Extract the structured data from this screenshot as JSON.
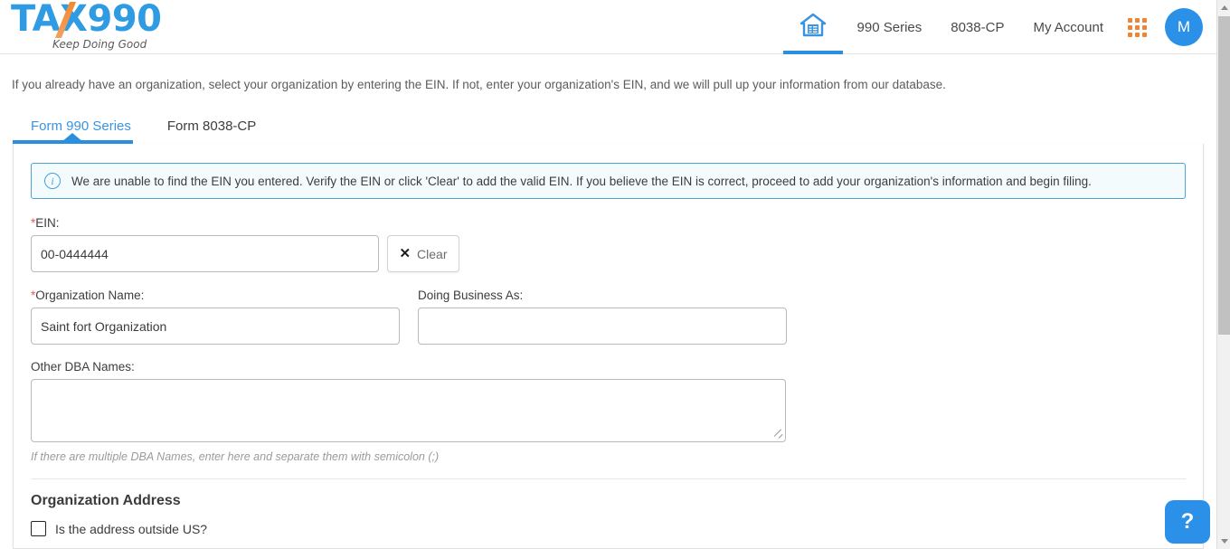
{
  "header": {
    "logo": {
      "text_main": "TA",
      "text_x": "X",
      "text_end": "990",
      "tagline": "Keep Doing Good"
    },
    "nav": {
      "home_icon": "home-icon",
      "links": [
        {
          "label": "990 Series"
        },
        {
          "label": "8038-CP"
        },
        {
          "label": "My Account"
        }
      ],
      "apps_icon": "apps-grid-icon",
      "avatar_initial": "M"
    }
  },
  "intro": {
    "text": "If you already have an organization, select your organization by entering the EIN. If not, enter your organization's EIN, and we will pull up your information from our database."
  },
  "tabs": [
    {
      "label": "Form 990 Series",
      "active": true
    },
    {
      "label": "Form 8038-CP",
      "active": false
    }
  ],
  "alert": {
    "icon": "info-circle-icon",
    "text": "We are unable to find the EIN you entered. Verify the EIN or click 'Clear' to add the valid EIN. If you believe the EIN is correct, proceed to add your organization's information and begin filing."
  },
  "form": {
    "ein": {
      "label": "EIN:",
      "required_marker": "*",
      "value": "00-0444444",
      "placeholder": ""
    },
    "clear_button": {
      "label": "Clear",
      "icon": "close-x-icon"
    },
    "organization_name": {
      "label": "Organization Name:",
      "required_marker": "*",
      "value": "Saint fort Organization",
      "placeholder": ""
    },
    "doing_business_as": {
      "label": "Doing Business As:",
      "value": "",
      "placeholder": ""
    },
    "other_dba_names": {
      "label": "Other DBA Names:",
      "value": "",
      "placeholder": "",
      "hint": "If there are multiple DBA Names, enter here and separate them with semicolon (;)"
    },
    "address_section": {
      "heading": "Organization Address",
      "outside_us_checkbox": {
        "label": "Is the address outside US?",
        "checked": false
      }
    }
  },
  "help_button": {
    "label": "?"
  },
  "colors": {
    "brand_blue": "#2f9be3",
    "accent_orange": "#ef8534",
    "nav_active": "#2b8fe0",
    "required_red": "#e8604c",
    "alert_border": "#4ea3d6",
    "alert_bg": "#f4fbfd"
  }
}
